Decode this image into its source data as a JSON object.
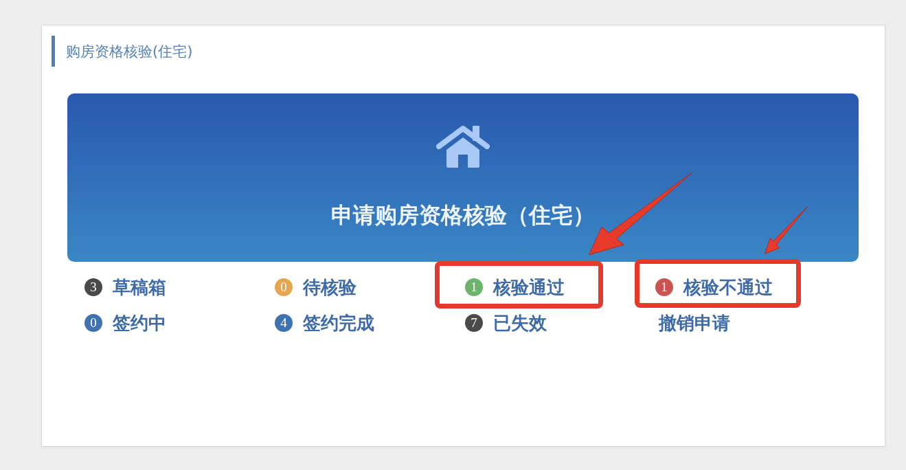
{
  "panel": {
    "title": "购房资格核验(住宅)"
  },
  "banner": {
    "title": "申请购房资格核验（住宅）"
  },
  "links": [
    {
      "kind": "status",
      "count": "3",
      "label": "草稿箱",
      "color": "#4a4a4a",
      "highlighted": false
    },
    {
      "kind": "status",
      "count": "0",
      "label": "待核验",
      "color": "#e4a651",
      "highlighted": false
    },
    {
      "kind": "status",
      "count": "1",
      "label": "核验通过",
      "color": "#6bb46b",
      "highlighted": true
    },
    {
      "kind": "status",
      "count": "1",
      "label": "核验不通过",
      "color": "#c95452",
      "highlighted": true
    },
    {
      "kind": "status",
      "count": "0",
      "label": "签约中",
      "color": "#3f72b0",
      "highlighted": false
    },
    {
      "kind": "status",
      "count": "4",
      "label": "签约完成",
      "color": "#3f72b0",
      "highlighted": false
    },
    {
      "kind": "status",
      "count": "7",
      "label": "已失效",
      "color": "#4a4a4a",
      "highlighted": false
    },
    {
      "kind": "action",
      "label": "撤销申请",
      "highlighted": false
    }
  ]
}
